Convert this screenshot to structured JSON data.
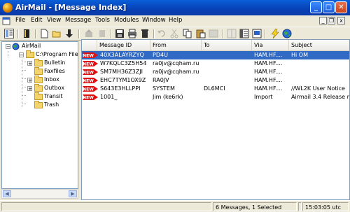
{
  "window": {
    "title": "AirMail - [Message Index]"
  },
  "window_controls": {
    "minimize": "_",
    "maximize": "□",
    "close": "✕"
  },
  "mdi_controls": {
    "minimize": "_",
    "restore": "❐",
    "close": "x"
  },
  "menu": [
    "File",
    "Edit",
    "View",
    "Message",
    "Tools",
    "Modules",
    "Window",
    "Help"
  ],
  "tree": {
    "root": "AirMail",
    "path": "C:\\Program Files",
    "folders": [
      "Bulletin",
      "Faxfiles",
      "Inbox",
      "Outbox",
      "Transit",
      "Trash"
    ],
    "expandable": {
      "Bulletin": "+",
      "Inbox": "+",
      "Outbox": "+"
    }
  },
  "columns": [
    "Message ID",
    "From",
    "To",
    "Via",
    "Subject"
  ],
  "messages": [
    {
      "id": "40X3ALAYRZYQ",
      "from": "PD4U",
      "to": "",
      "via": "HAM.HF....",
      "subject": "Hi OM",
      "selected": true,
      "is_new": true
    },
    {
      "id": "W7KQLC3Z5H54",
      "from": "ra0jv@cqham.ru",
      "to": "",
      "via": "HAM.HF....",
      "subject": "",
      "selected": false,
      "is_new": true
    },
    {
      "id": "SM7MH36Z3ZJI",
      "from": "ra0jv@cqham.ru",
      "to": "",
      "via": "HAM.HF....",
      "subject": "",
      "selected": false,
      "is_new": true
    },
    {
      "id": "EHC7TYM1OX9Z",
      "from": "RA0JV",
      "to": "",
      "via": "HAM.HF....",
      "subject": "",
      "selected": false,
      "is_new": true
    },
    {
      "id": "S643E3HLLPPI",
      "from": "SYSTEM",
      "to": "DL6MCI",
      "via": "HAM.HF....",
      "subject": "//WL2K User Notice",
      "selected": false,
      "is_new": true
    },
    {
      "id": "1001_",
      "from": "Jim (ke6rk)",
      "to": "",
      "via": "Import",
      "subject": "Airmail 3.4 Release no",
      "selected": false,
      "is_new": true
    }
  ],
  "new_badge": "NEW",
  "status": {
    "left": "",
    "messages": "6 Messages, 1 Selected",
    "middle": "",
    "time": "15:03:05 utc"
  },
  "colors": {
    "titlebar": "#0842b8",
    "selection": "#316ac5",
    "folder": "#f3d36b"
  }
}
